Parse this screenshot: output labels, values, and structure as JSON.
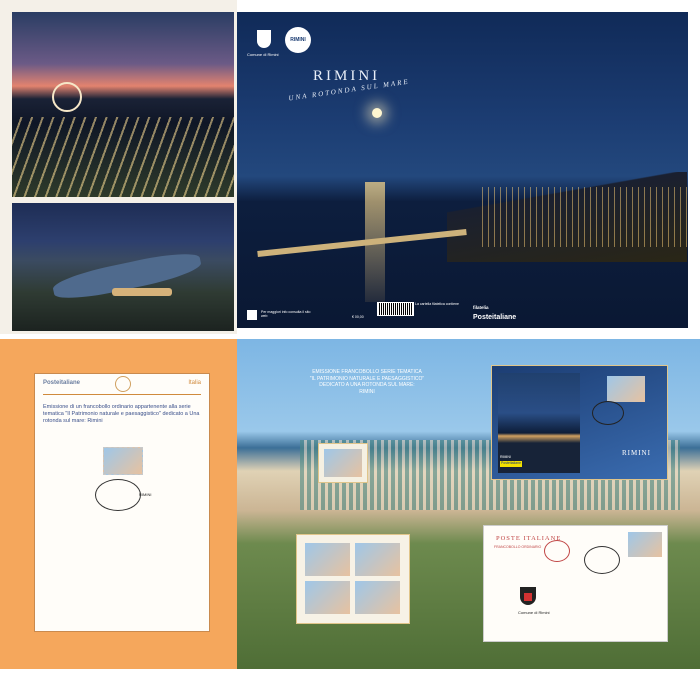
{
  "top": {
    "cover_title": "RIMINI",
    "cover_subtitle": "UNA ROTONDA SUL MARE",
    "comune_label": "Comune di Rimini",
    "circle_logo": "RIMINI",
    "qr_text": "Per maggiori info consulta il sito web",
    "price": "€ 00,00",
    "copy_text": "La cartella filatelica contiene",
    "filatelia": "filatelia",
    "poste": "Posteitaliane"
  },
  "sheet": {
    "poste": "Posteitaliane",
    "italia": "Italia",
    "text": "Emissione di un francobollo ordinario appartenente alla serie tematica \"Il Patrimonio naturale e paesaggistico\" dedicato a Una rotonda sul mare: Rimini",
    "cancel_text": "RIMINI"
  },
  "bottom": {
    "line1": "EMISSIONE FRANCOBOLLO SERIE TEMATICA",
    "line2": "\"IL PATRIMONIO NATURALE E PAESAGGISTICO\"",
    "line3": "DEDICATO A UNA ROTONDA SUL MARE:",
    "line4": "RIMINI",
    "folder_rimini": "RIMINI",
    "folder_label": "RIMINI",
    "folder_poste": "Posteitaliane",
    "fdc_title": "POSTE ITALIANE",
    "fdc_sub": "FRANCOBOLLO ORDINARIO",
    "fdc_comune": "Comune di Rimini"
  }
}
